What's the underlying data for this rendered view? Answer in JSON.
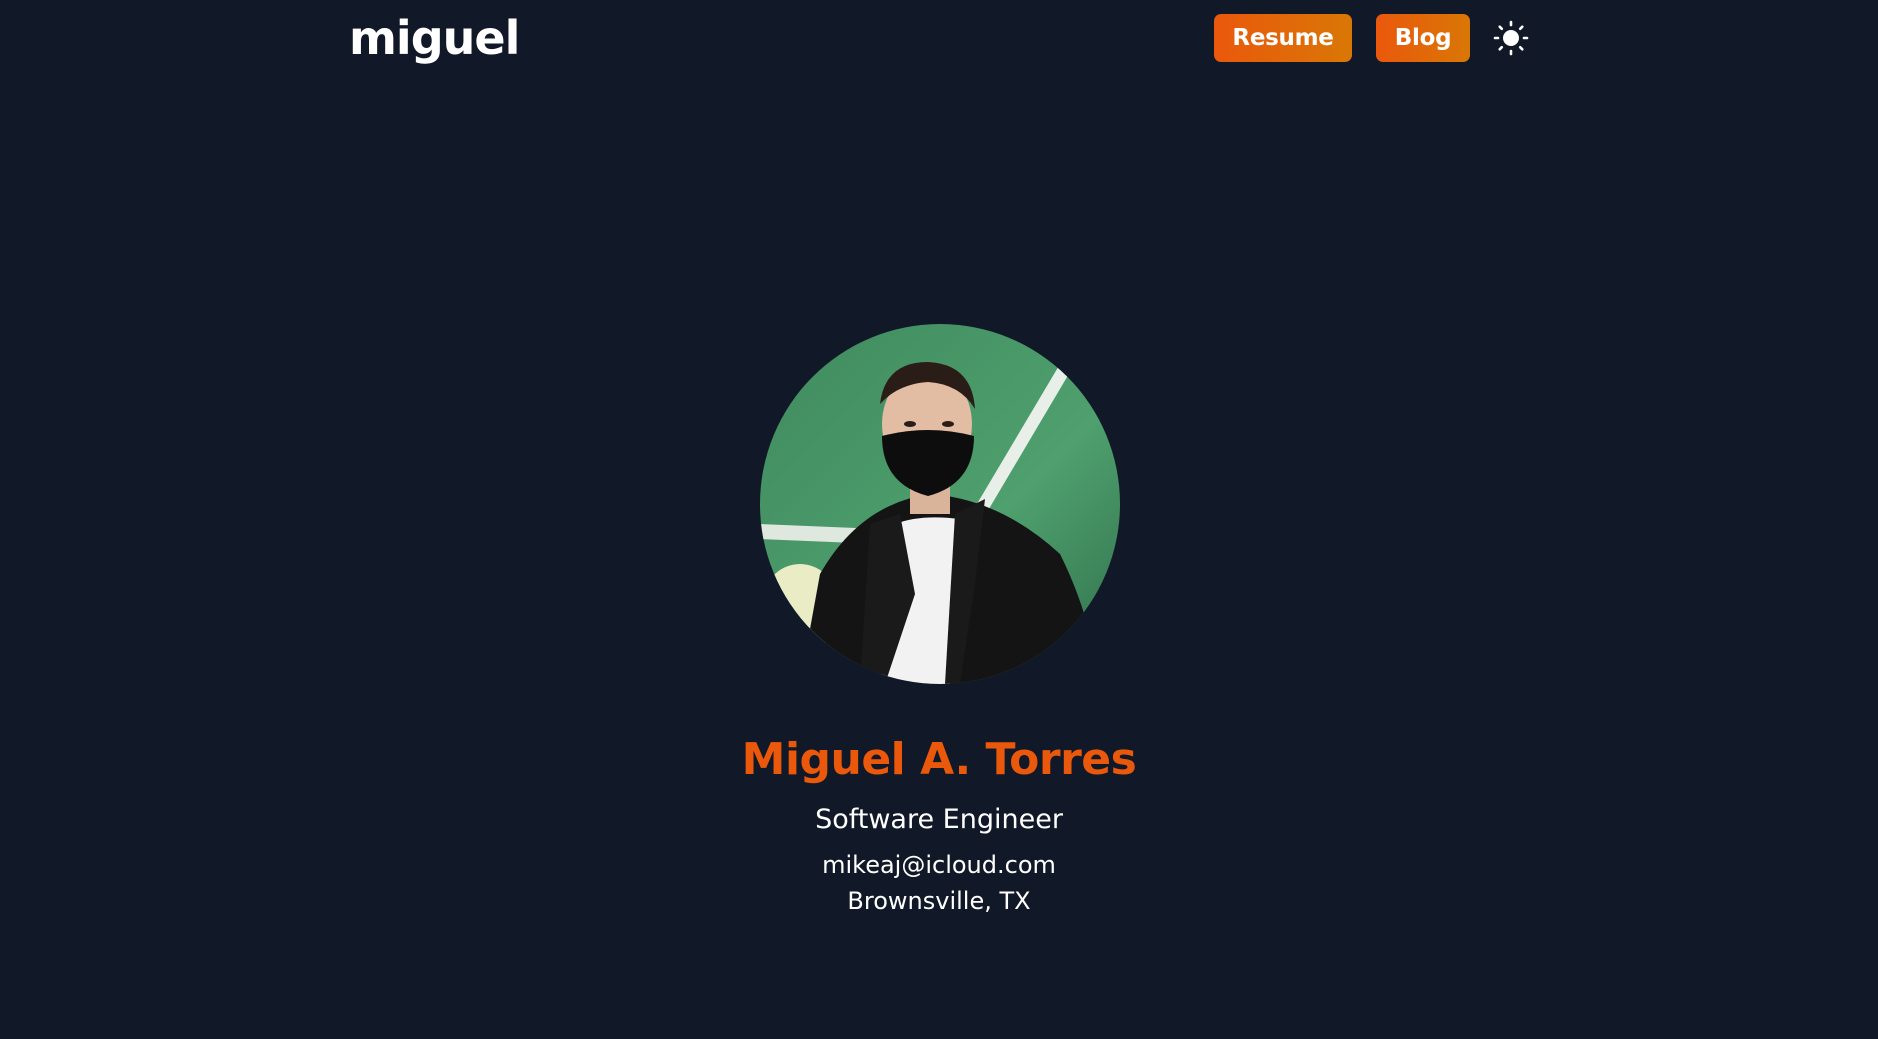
{
  "header": {
    "logo": "miguel",
    "nav": {
      "resume_label": "Resume",
      "blog_label": "Blog"
    },
    "theme_toggle_icon": "sun-icon"
  },
  "profile": {
    "avatar_icon": "profile-photo",
    "name": "Miguel A. Torres",
    "role": "Software Engineer",
    "email": "mikeaj@icloud.com",
    "location": "Brownsville, TX"
  },
  "colors": {
    "background": "#111827",
    "accent": "#ea580c",
    "accent_gradient_end": "#d97706",
    "text": "#ffffff"
  }
}
